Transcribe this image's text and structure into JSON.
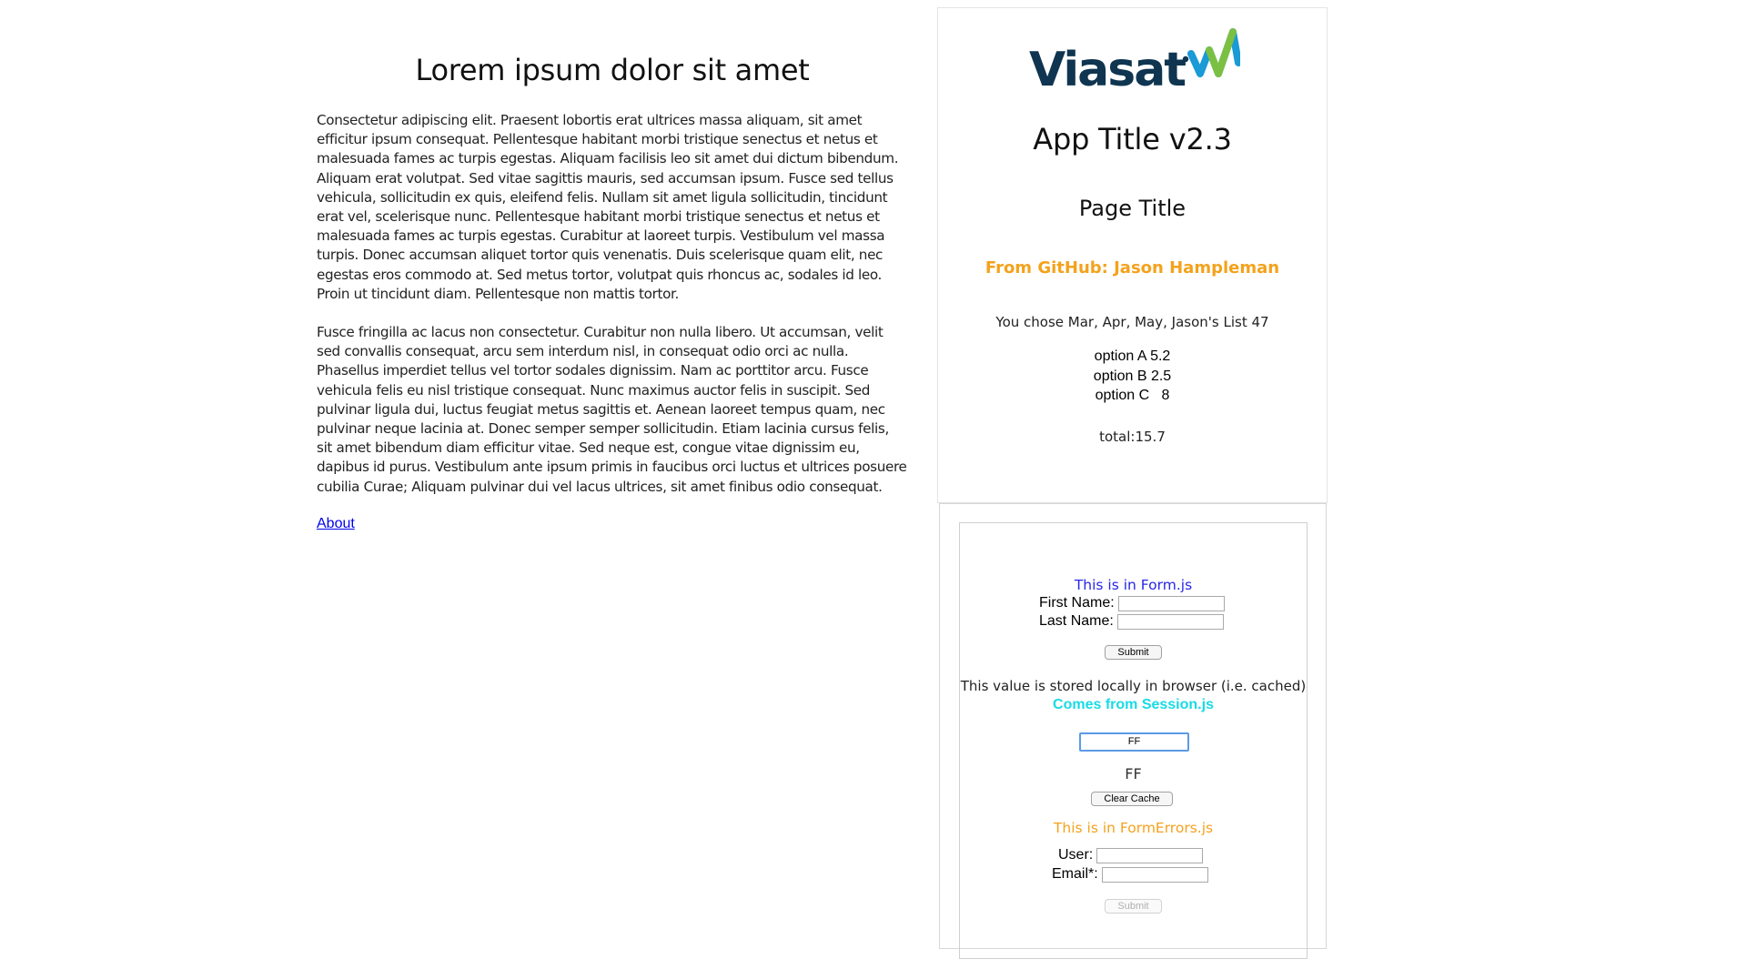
{
  "main": {
    "heading": "Lorem ipsum dolor sit amet",
    "paragraphs": [
      "Consectetur adipiscing elit. Praesent lobortis erat ultrices massa aliquam, sit amet efficitur ipsum consequat. Pellentesque habitant morbi tristique senectus et netus et malesuada fames ac turpis egestas. Aliquam facilisis leo sit amet dui dictum bibendum. Aliquam erat volutpat. Sed vitae sagittis mauris, sed accumsan ipsum. Fusce sed tellus vehicula, sollicitudin ex quis, eleifend felis. Nullam sit amet ligula sollicitudin, tincidunt erat vel, scelerisque nunc. Pellentesque habitant morbi tristique senectus et netus et malesuada fames ac turpis egestas. Curabitur at laoreet turpis. Vestibulum vel massa turpis. Donec accumsan aliquet tortor quis venenatis. Duis scelerisque quam elit, nec egestas eros commodo at. Sed metus tortor, volutpat quis rhoncus ac, sodales id leo. Proin ut tincidunt diam. Pellentesque non mattis tortor.",
      "Fusce fringilla ac lacus non consectetur. Curabitur non nulla libero. Ut accumsan, velit sed convallis consequat, arcu sem interdum nisl, in consequat odio orci ac nulla. Phasellus imperdiet tellus vel tortor sodales dignissim. Nam ac porttitor arcu. Fusce vehicula felis eu nisl tristique consequat. Nunc maximus auctor felis in suscipit. Sed pulvinar ligula dui, luctus feugiat metus sagittis et. Aenean laoreet tempus quam, nec pulvinar neque lacinia at. Donec semper semper sollicitudin. Etiam lacinia cursus felis, sit amet bibendum diam efficitur vitae. Sed neque est, congue vitae dignissim eu, dapibus id purus. Vestibulum ante ipsum primis in faucibus orci luctus et ultrices posuere cubilia Curae; Aliquam pulvinar dui vel lacus ultrices, sit amet finibus odio consequat."
    ],
    "about_link": "About"
  },
  "sidebar": {
    "logo_text": "Viasat",
    "logo_trademark": "™",
    "app_title": "App Title v2.3",
    "page_title": "Page Title",
    "github_line": "From GitHub: Jason Hampleman",
    "chose_line": "You chose Mar, Apr, May, Jason's List 47",
    "options": [
      "option A 5.2",
      "option B 2.5",
      "option C   8"
    ],
    "total": "total:15.7"
  },
  "form": {
    "title": "This is in Form.js",
    "first_name_label": "First Name:",
    "last_name_label": "Last Name:",
    "first_name_value": "",
    "last_name_value": "",
    "submit_label": "Submit",
    "cache_text": "This value is stored locally in browser (i.e. cached)",
    "session_text": "Comes from Session.js",
    "cache_input_value": "FF",
    "cached_display": "FF",
    "clear_cache_label": "Clear Cache"
  },
  "form_errors": {
    "title": "This is in FormErrors.js",
    "user_label": "User:",
    "email_label": "Email*:",
    "user_value": "",
    "email_value": "",
    "submit_label": "Submit"
  },
  "colors": {
    "orange_accent": "#f4a21c",
    "form_title_blue": "#2727e6",
    "session_cyan": "#18dbe6",
    "logo_navy": "#0f3550",
    "link_blue": "#0000ee"
  }
}
